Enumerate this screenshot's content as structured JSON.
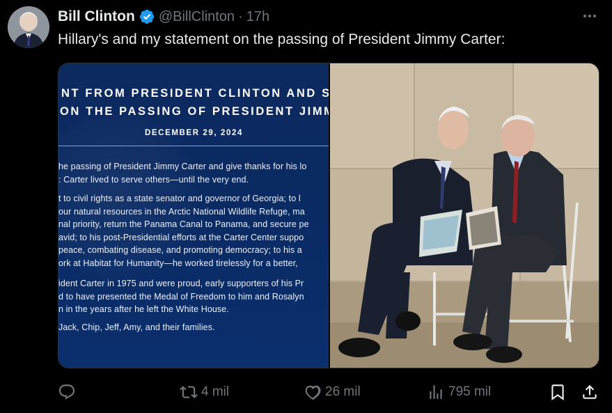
{
  "post": {
    "author_name": "Bill Clinton",
    "handle": "@BillClinton",
    "separator": "·",
    "time": "17h",
    "text": "Hillary's and my statement on the passing of President Jimmy Carter:"
  },
  "statement": {
    "title_line1": "NT FROM PRESIDENT CLINTON AND SEC",
    "title_line2": "ON THE PASSING OF PRESIDENT JIMMY",
    "date": "DECEMBER 29, 2024",
    "para1": [
      "he passing of President Jimmy Carter and give thanks for his lo",
      ": Carter lived to serve others—until the very end."
    ],
    "para2": [
      "t to civil rights as a state senator and governor of Georgia; to l",
      "our natural resources in the Arctic National Wildlife Refuge, ma",
      "nal priority, return the Panama Canal to Panama, and secure pe",
      "avid; to his post-Presidential efforts at the Carter Center suppo",
      "peace, combating disease, and promoting democracy; to his a",
      "ork at Habitat for Humanity—he worked tirelessly for a better, "
    ],
    "para3": [
      "ident Carter in 1975 and were proud, early supporters of his Pr",
      "d to have presented the Medal of Freedom to him and Rosalyn",
      "n in the years after he left the White House."
    ],
    "para4": [
      "Jack, Chip, Jeff, Amy, and their families."
    ]
  },
  "actions": {
    "reply_count": "",
    "repost_count": "4 mil",
    "like_count": "26 mil",
    "views_count": "795 mil"
  },
  "icons": {
    "verified": "verified-badge-icon",
    "more": "more-dots-icon",
    "reply": "reply-icon",
    "repost": "repost-icon",
    "like": "heart-icon",
    "views": "views-icon",
    "bookmark": "bookmark-icon",
    "share": "share-icon"
  },
  "colors": {
    "background": "#000000",
    "text_primary": "#e7e9ea",
    "text_secondary": "#71767b",
    "verified_blue": "#1d9bf0",
    "statement_navy": "#0b2a63"
  }
}
